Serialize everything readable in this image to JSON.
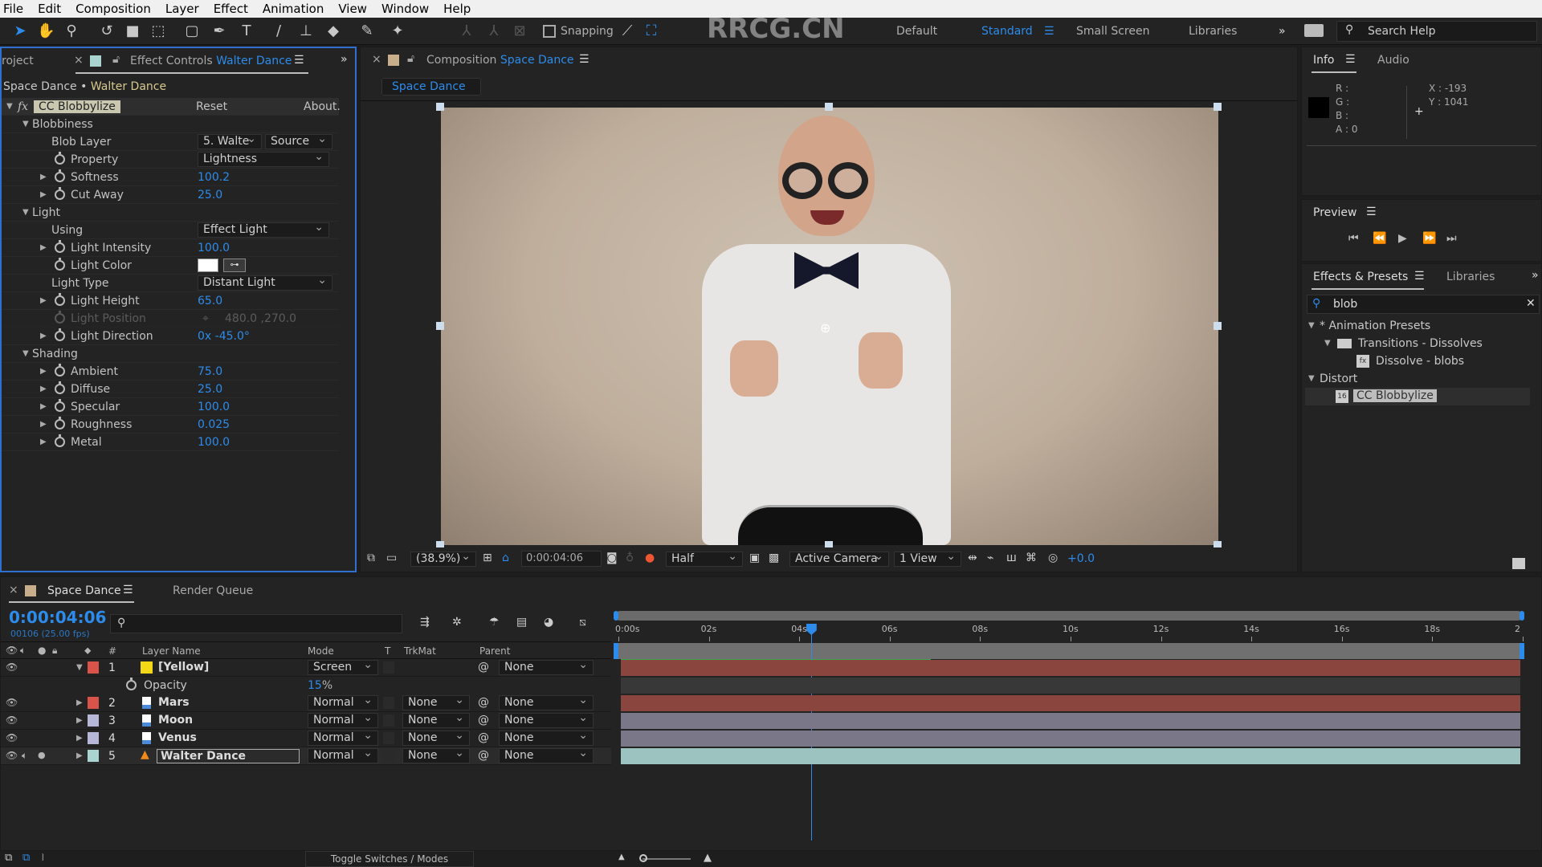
{
  "menu": [
    "File",
    "Edit",
    "Composition",
    "Layer",
    "Effect",
    "Animation",
    "View",
    "Window",
    "Help"
  ],
  "toolbar": {
    "snapping_label": "Snapping",
    "watermark": "RRCG.CN",
    "workspaces": [
      "Default",
      "Standard",
      "Small Screen",
      "Libraries"
    ],
    "active_workspace": "Standard",
    "search_help_placeholder": "Search Help"
  },
  "project_tab": "roject",
  "effect_controls": {
    "tab_prefix": "Effect Controls",
    "tab_layer": "Walter Dance",
    "breadcrumb_comp": "Space Dance",
    "breadcrumb_layer": "Walter Dance",
    "effect_name": "CC Blobbylize",
    "reset": "Reset",
    "about": "About.",
    "groups": {
      "blobbiness": "Blobbiness",
      "light": "Light",
      "shading": "Shading"
    },
    "blob_layer": {
      "label": "Blob Layer",
      "layer": "5. Walte",
      "channel": "Source"
    },
    "property": {
      "label": "Property",
      "value": "Lightness"
    },
    "softness": {
      "label": "Softness",
      "value": "100.2"
    },
    "cut_away": {
      "label": "Cut Away",
      "value": "25.0"
    },
    "using": {
      "label": "Using",
      "value": "Effect Light"
    },
    "light_intensity": {
      "label": "Light Intensity",
      "value": "100.0"
    },
    "light_color": {
      "label": "Light Color",
      "value": "#ffffff"
    },
    "light_type": {
      "label": "Light Type",
      "value": "Distant Light"
    },
    "light_height": {
      "label": "Light Height",
      "value": "65.0"
    },
    "light_position": {
      "label": "Light Position",
      "value": "480.0 ,270.0"
    },
    "light_direction": {
      "label": "Light Direction",
      "value": "0x -45.0°"
    },
    "ambient": {
      "label": "Ambient",
      "value": "75.0"
    },
    "diffuse": {
      "label": "Diffuse",
      "value": "25.0"
    },
    "specular": {
      "label": "Specular",
      "value": "100.0"
    },
    "roughness": {
      "label": "Roughness",
      "value": "0.025"
    },
    "metal": {
      "label": "Metal",
      "value": "100.0"
    }
  },
  "composition": {
    "tab_prefix": "Composition",
    "tab_name": "Space Dance",
    "subtab": "Space Dance",
    "zoom": "(38.9%)",
    "timecode": "0:00:04:06",
    "resolution": "Half",
    "camera": "Active Camera",
    "views": "1 View",
    "exposure": "+0.0"
  },
  "info": {
    "tab": "Info",
    "audio_tab": "Audio",
    "r": "R :",
    "g": "G :",
    "b": "B :",
    "a": "A : 0",
    "x": "X : -193",
    "y": "Y : 1041"
  },
  "preview": {
    "title": "Preview"
  },
  "effects_presets": {
    "tab": "Effects & Presets",
    "libraries_tab": "Libraries",
    "search_value": "blob",
    "tree": [
      {
        "label": "* Animation Presets",
        "level": 0
      },
      {
        "label": "Transitions - Dissolves",
        "level": 1
      },
      {
        "label": "Dissolve - blobs",
        "level": 2
      },
      {
        "label": "Distort",
        "level": 0
      },
      {
        "label": "CC Blobbylize",
        "level": 1
      }
    ]
  },
  "timeline": {
    "tab": "Space Dance",
    "render_queue": "Render Queue",
    "timecode": "0:00:04:06",
    "frame_info": "00106 (25.00 fps)",
    "columns": {
      "layer_name": "Layer Name",
      "mode": "Mode",
      "t": "T",
      "trkmat": "TrkMat",
      "parent": "Parent",
      "num": "#"
    },
    "layers": [
      {
        "num": "1",
        "name": "[Yellow]",
        "label_color": "#d9534a",
        "mode": "Screen",
        "trkmat": "",
        "parent": "None",
        "bar_color": "#8a453f"
      },
      {
        "num": "2",
        "name": "Mars",
        "label_color": "#d9534a",
        "mode": "Normal",
        "trkmat": "None",
        "parent": "None",
        "bar_color": "#8a453f"
      },
      {
        "num": "3",
        "name": "Moon",
        "label_color": "#b7b7d8",
        "mode": "Normal",
        "trkmat": "None",
        "parent": "None",
        "bar_color": "#7a7888"
      },
      {
        "num": "4",
        "name": "Venus",
        "label_color": "#b7b7d8",
        "mode": "Normal",
        "trkmat": "None",
        "parent": "None",
        "bar_color": "#7a7888"
      },
      {
        "num": "5",
        "name": "Walter Dance",
        "label_color": "#a9d4cf",
        "mode": "Normal",
        "trkmat": "None",
        "parent": "None",
        "bar_color": "#9dc3c0"
      }
    ],
    "opacity": {
      "label": "Opacity",
      "value": "15",
      "unit": "%"
    },
    "ruler": [
      "0:00s",
      "02s",
      "04s",
      "06s",
      "08s",
      "10s",
      "12s",
      "14s",
      "16s",
      "18s",
      "2"
    ],
    "current_time_fraction": 0.213,
    "work_area_rendered_fraction": 0.345,
    "toggle_label": "Toggle Switches / Modes"
  }
}
